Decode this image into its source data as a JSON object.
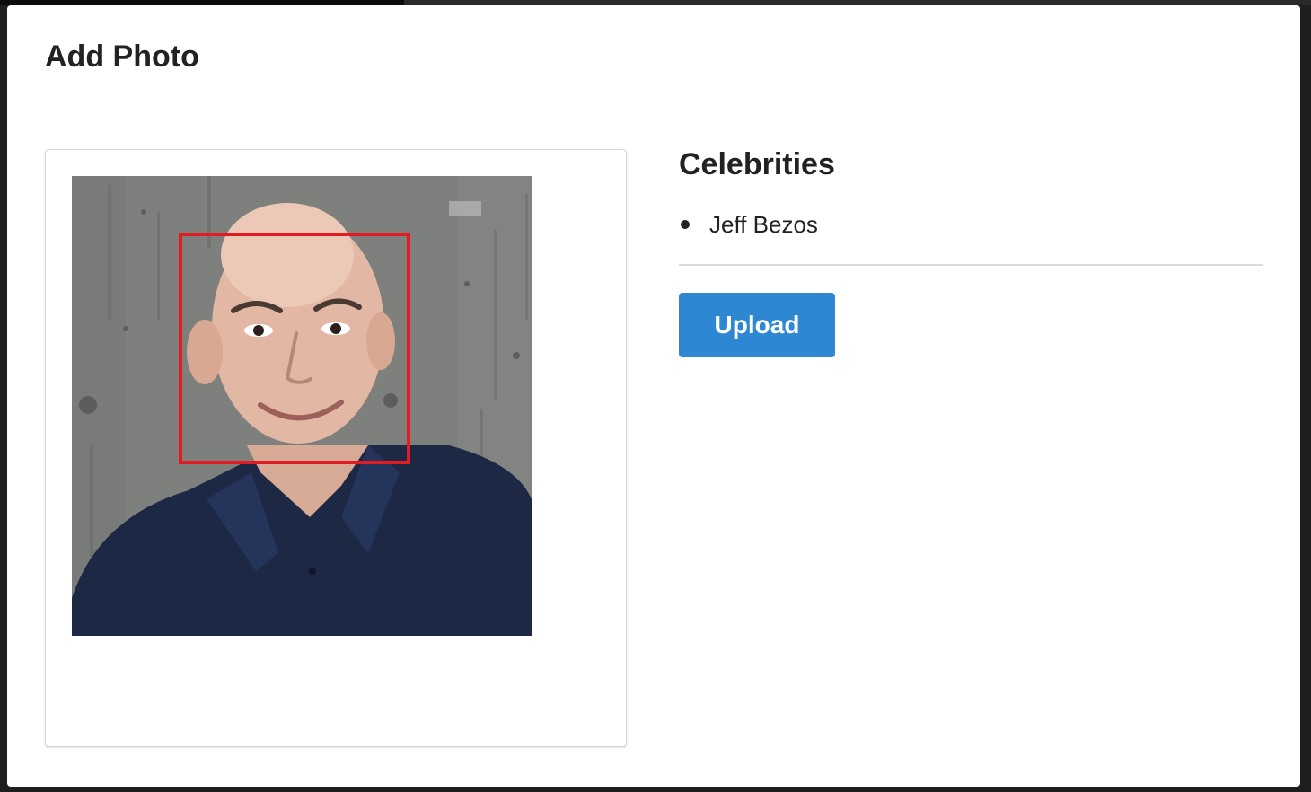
{
  "modal": {
    "title": "Add Photo"
  },
  "photo": {
    "face_box_color": "#e41b23"
  },
  "celebrities": {
    "title": "Celebrities",
    "items": [
      {
        "name": "Jeff Bezos"
      }
    ]
  },
  "actions": {
    "upload_label": "Upload",
    "upload_color": "#2d87d3"
  }
}
